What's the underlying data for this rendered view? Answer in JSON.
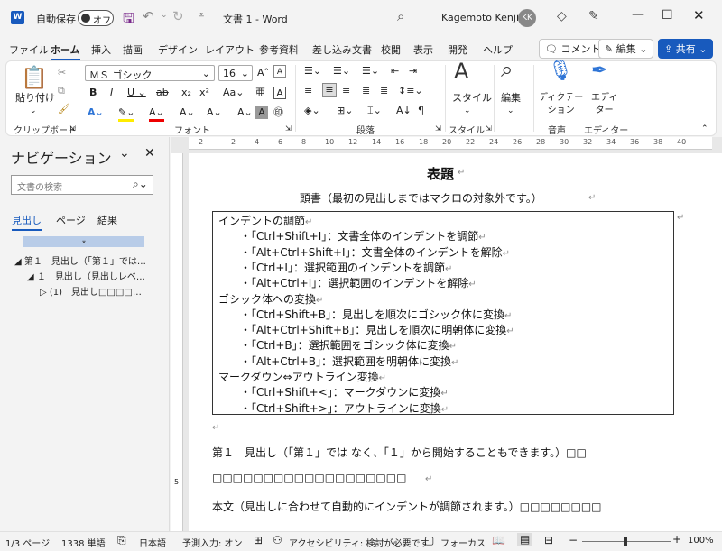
{
  "titlebar": {
    "autosave_label": "自動保存",
    "autosave_state": "オフ",
    "doc_title": "文書 1 - Word",
    "user_name": "Kagemoto Kenji",
    "avatar_initials": "KK"
  },
  "menu": [
    "ファイル",
    "ホーム",
    "挿入",
    "描画",
    "デザイン",
    "レイアウト",
    "参考資料",
    "差し込み文書",
    "校閲",
    "表示",
    "開発",
    "ヘルプ"
  ],
  "comment_button": "コメント",
  "edit_button": "編集",
  "share_button": "共有",
  "ribbon": {
    "paste": "貼り付け",
    "clipboard_group": "クリップボード",
    "font_name": "ＭＳ ゴシック",
    "font_size": "16",
    "font_group": "フォント",
    "paragraph_group": "段落",
    "style_label": "スタイル",
    "style_group": "スタイル",
    "editing_label": "編集",
    "dictation_label": "ディクテー\nション",
    "voice_group": "音声",
    "editor_label": "エディ\nター",
    "editor_group": "エディター"
  },
  "navigation": {
    "title": "ナビゲーション",
    "search_placeholder": "文書の検索",
    "tabs": [
      "見出し",
      "ページ",
      "結果"
    ],
    "tree": [
      {
        "label": "第１　見出し（「第１」では…",
        "level": 0
      },
      {
        "label": "１　見出し（見出しレベ…",
        "level": 1
      },
      {
        "label": "(1)　見出し□□□□…",
        "level": 2
      }
    ]
  },
  "ruler": {
    "marks": [
      "2",
      "2",
      "4",
      "6",
      "8",
      "10",
      "12",
      "14",
      "16",
      "18",
      "20",
      "22",
      "24",
      "26",
      "28",
      "30",
      "32",
      "34",
      "36",
      "38",
      "40"
    ]
  },
  "document": {
    "title": "表題",
    "preface": "頭書（最初の見出しまではマクロの対象外です。）",
    "box": [
      {
        "t": "インデントの調節",
        "l": 0
      },
      {
        "t": "・「Ctrl+Shift+I」：文書全体のインデントを調節",
        "l": 1
      },
      {
        "t": "・「Alt+Ctrl+Shift+I」：文書全体のインデントを解除",
        "l": 1
      },
      {
        "t": "・「Ctrl+I」：選択範囲のインデントを調節",
        "l": 1
      },
      {
        "t": "・「Alt+Ctrl+I」：選択範囲のインデントを解除",
        "l": 1
      },
      {
        "t": "ゴシック体への変換",
        "l": 0
      },
      {
        "t": "・「Ctrl+Shift+B」：見出しを順次にゴシック体に変換",
        "l": 1
      },
      {
        "t": "・「Alt+Ctrl+Shift+B」：見出しを順次に明朝体に変換",
        "l": 1
      },
      {
        "t": "・「Ctrl+B」：選択範囲をゴシック体に変換",
        "l": 1
      },
      {
        "t": "・「Alt+Ctrl+B」：選択範囲を明朝体に変換",
        "l": 1
      },
      {
        "t": "マークダウン⇔アウトライン変換",
        "l": 0
      },
      {
        "t": "・「Ctrl+Shift+<」：マークダウンに変換",
        "l": 1
      },
      {
        "t": "・「Ctrl+Shift+>」：アウトラインに変換",
        "l": 1
      }
    ],
    "heading1": "第１　見出し（「第１」では なく、「１」から開始することもできます。）□□",
    "heading1_cont": "□□□□□□□□□□□□□□□□□□□",
    "body": "本文（見出しに合わせて自動的にインデントが調節されます。）□□□□□□□□",
    "left_mark": "5"
  },
  "status": {
    "page": "1/3 ページ",
    "words": "1338 単語",
    "lang": "日本語",
    "predict": "予測入力: オン",
    "access": "アクセシビリティ: 検討が必要です",
    "focus": "フォーカス",
    "zoom": "100%"
  }
}
